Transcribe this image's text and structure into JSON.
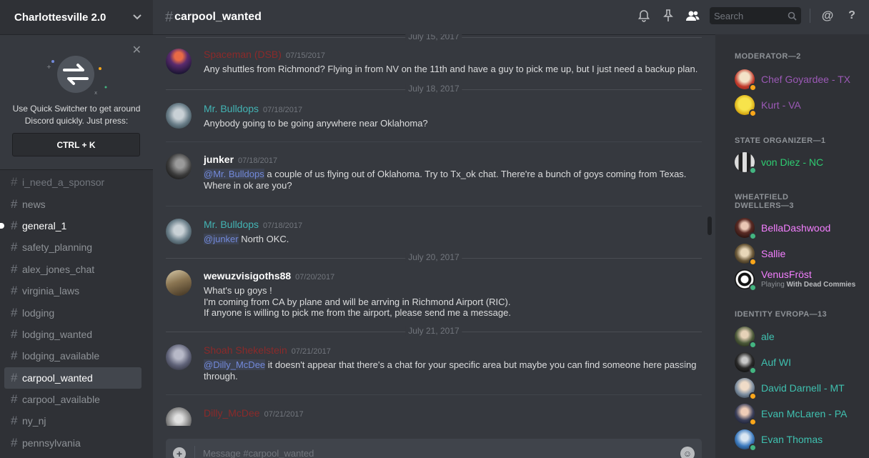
{
  "sidebar": {
    "guild_name": "Charlottesville 2.0",
    "quick_switcher": {
      "text": "Use Quick Switcher to get around Discord quickly. Just press:",
      "shortcut": "CTRL + K"
    },
    "channels": [
      {
        "name": "i_need_a_sponsor",
        "state": "muted"
      },
      {
        "name": "news",
        "state": "normal"
      },
      {
        "name": "general_1",
        "state": "unread"
      },
      {
        "name": "safety_planning",
        "state": "normal"
      },
      {
        "name": "alex_jones_chat",
        "state": "normal"
      },
      {
        "name": "virginia_laws",
        "state": "normal"
      },
      {
        "name": "lodging",
        "state": "normal"
      },
      {
        "name": "lodging_wanted",
        "state": "normal"
      },
      {
        "name": "lodging_available",
        "state": "normal"
      },
      {
        "name": "carpool_wanted",
        "state": "active"
      },
      {
        "name": "carpool_available",
        "state": "normal"
      },
      {
        "name": "ny_nj",
        "state": "normal"
      },
      {
        "name": "pennsylvania",
        "state": "normal"
      }
    ]
  },
  "header": {
    "hash": "#",
    "channel": "carpool_wanted",
    "search_placeholder": "Search",
    "icons": [
      "bell-icon",
      "pin-icon",
      "members-icon",
      "search-icon",
      "at-icon",
      "help-icon"
    ]
  },
  "messages": {
    "dates": [
      "July 15, 2017",
      "July 18, 2017",
      "July 20, 2017",
      "July 21, 2017"
    ],
    "items": [
      {
        "author": "Spaceman (DSB)",
        "color": "#8b2a2a",
        "time": "07/15/2017",
        "text": "Any shuttles from Richmond? Flying in from NV on the 11th and have a guy to pick me up, but I just need a backup plan."
      },
      {
        "author": "Mr. Bulldops",
        "color": "#43b4b4",
        "time": "07/18/2017",
        "text": "Anybody going to be going anywhere near Oklahoma?"
      },
      {
        "author": "junker",
        "color": "#ffffff",
        "time": "07/18/2017",
        "mention": "@Mr. Bulldops",
        "text": " a couple of us flying out of Oklahoma. Try to Tx_ok chat. There're a bunch of goys coming from Texas. Where in ok are you?"
      },
      {
        "author": "Mr. Bulldops",
        "color": "#43b4b4",
        "time": "07/18/2017",
        "mention": "@junker",
        "text": " North OKC."
      },
      {
        "author": "wewuzvisigoths88",
        "color": "#ffffff",
        "time": "07/20/2017",
        "text": "What's up goys !\nI'm coming from CA by plane and will be arrving in Richmond Airport (RIC).\nIf anyone is willing to pick me from the airport, please send me a message."
      },
      {
        "author": "Shoah Shekelstein",
        "color": "#8b2a2a",
        "time": "07/21/2017",
        "mention": "@Dilly_McDee",
        "text": " it doesn't appear that there's a chat for your specific area but maybe you can find someone here passing through."
      },
      {
        "author": "Dilly_McDee",
        "color": "#8b2a2a",
        "time": "07/21/2017",
        "text": ""
      }
    ]
  },
  "composer": {
    "placeholder": "Message #carpool_wanted"
  },
  "members": {
    "groups": [
      {
        "role": "MODERATOR—2",
        "members": [
          {
            "name": "Chef Goyardee - TX",
            "color": "#9b59b6",
            "status": "#faa61a"
          },
          {
            "name": "Kurt - VA",
            "color": "#9b59b6",
            "status": "#faa61a"
          }
        ]
      },
      {
        "role": "STATE ORGANIZER—1",
        "members": [
          {
            "name": "von Diez - NC",
            "color": "#2ecc71",
            "status": "#43b581"
          }
        ]
      },
      {
        "role": "WHEATFIELD DWELLERS—3",
        "members": [
          {
            "name": "BellaDashwood",
            "color": "#f47fff",
            "status": "#43b581"
          },
          {
            "name": "Sallie",
            "color": "#f47fff",
            "status": "#faa61a"
          },
          {
            "name": "VenusFröst",
            "color": "#f47fff",
            "status": "#43b581",
            "playing_prefix": "Playing ",
            "playing": "With Dead Commies"
          }
        ]
      },
      {
        "role": "IDENTITY EVROPA—13",
        "members": [
          {
            "name": "ale",
            "color": "#3fc1b0",
            "status": "#43b581"
          },
          {
            "name": "Auf WI",
            "color": "#3fc1b0",
            "status": "#43b581"
          },
          {
            "name": "David Darnell - MT",
            "color": "#3fc1b0",
            "status": "#faa61a"
          },
          {
            "name": "Evan McLaren - PA",
            "color": "#3fc1b0",
            "status": "#faa61a"
          },
          {
            "name": "Evan Thomas",
            "color": "#3fc1b0",
            "status": "#43b581"
          }
        ]
      }
    ]
  }
}
